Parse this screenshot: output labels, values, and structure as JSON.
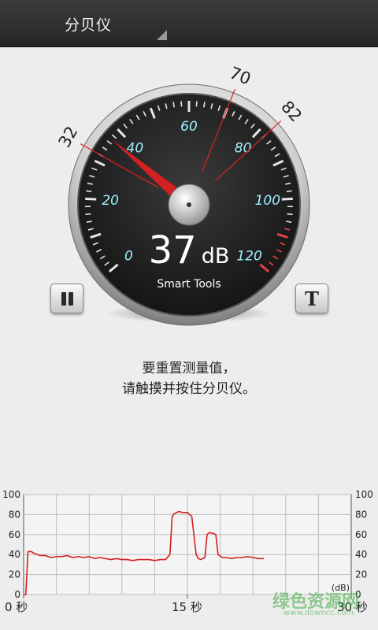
{
  "app_bar": {
    "title": "分贝仪"
  },
  "gauge": {
    "reading_value": "37",
    "reading_unit": "dB",
    "brand": "Smart Tools",
    "scale_labels": [
      "0",
      "20",
      "40",
      "60",
      "80",
      "100",
      "120"
    ],
    "scale_min": 0,
    "scale_max": 120,
    "current_value": 37,
    "markers": [
      {
        "label": "32",
        "value": 32
      },
      {
        "label": "70",
        "value": 70
      },
      {
        "label": "82",
        "value": 82
      }
    ],
    "colors": {
      "needle": "#d42020",
      "marker_line": "#e02020",
      "scale_text": "#9ff0ff",
      "danger_ticks": "#e84040"
    }
  },
  "controls": {
    "pause_icon": "pause-icon",
    "text_icon": "T"
  },
  "instructions": {
    "line1": "要重置测量值，",
    "line2": "请触摸并按住分贝仪。"
  },
  "chart_data": {
    "type": "line",
    "title": "",
    "xlabel": "",
    "ylabel": "(dB)",
    "xlim": [
      0,
      30
    ],
    "ylim": [
      0,
      100
    ],
    "y_ticks": [
      "0",
      "20",
      "40",
      "60",
      "80",
      "100"
    ],
    "x_tick_labels": [
      {
        "label": "0 秒",
        "value": 0
      },
      {
        "label": "15 秒",
        "value": 15
      },
      {
        "label": "30 秒",
        "value": 30
      }
    ],
    "grid": true,
    "series_color": "#d42020",
    "series": [
      {
        "x": [
          0,
          0.2,
          0.4,
          0.7,
          1.0,
          1.5,
          2.0,
          2.5,
          3.0,
          3.5,
          4.0,
          4.5,
          5.0,
          5.5,
          6.0,
          6.5,
          7.0,
          7.5,
          8.0,
          8.5,
          9.0,
          9.5,
          10.0,
          10.5,
          11.0,
          11.5,
          12.0,
          12.5,
          13.0,
          13.4,
          13.6,
          13.8,
          14.2,
          14.6,
          15.0,
          15.4,
          15.8,
          16.0,
          16.2,
          16.6,
          16.8,
          17.0,
          17.4,
          17.6,
          17.8,
          18.2,
          18.6,
          19.0,
          19.5,
          20.0,
          20.5,
          21.0,
          21.5,
          22.0
        ],
        "y": [
          0,
          0,
          43,
          43,
          41,
          39,
          39,
          37,
          38,
          38,
          39,
          37,
          38,
          37,
          38,
          36,
          37,
          36,
          35,
          36,
          35,
          35,
          34,
          35,
          35,
          35,
          34,
          35,
          35,
          40,
          78,
          81,
          83,
          82,
          82,
          78,
          40,
          36,
          35,
          37,
          60,
          62,
          61,
          60,
          40,
          37,
          37,
          36,
          37,
          37,
          38,
          37,
          36,
          36
        ]
      }
    ]
  },
  "watermark": {
    "text": "绿色资源网",
    "url": "www.downcc.com"
  }
}
